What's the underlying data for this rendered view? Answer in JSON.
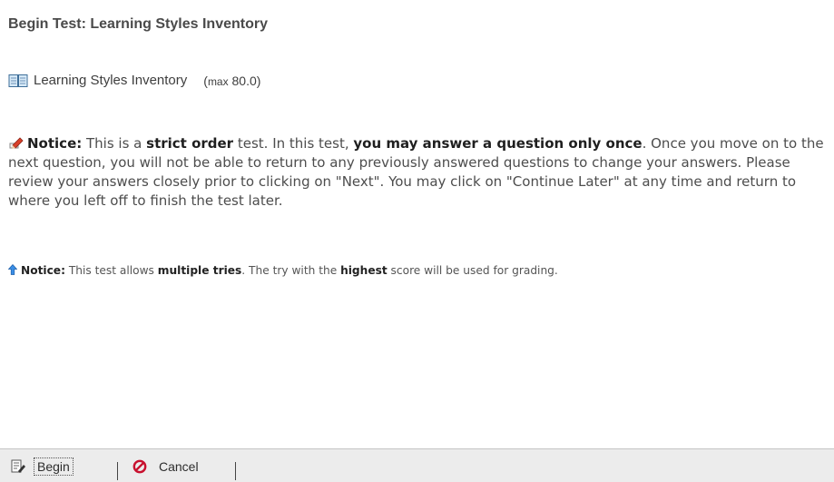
{
  "page": {
    "title": "Begin Test: Learning Styles Inventory"
  },
  "test": {
    "icon": "book-icon",
    "name": "Learning Styles Inventory",
    "max_open": "(",
    "max_label": "max",
    "max_value": " 80.0)"
  },
  "notice_strict": {
    "icon": "pencil-icon",
    "label": "Notice:",
    "t1": " This is a ",
    "b1": "strict order",
    "t2": " test. In this test, ",
    "b2": "you may answer a question only once",
    "t3": ". Once you move on to the next question, you will not be able to return to any previously answered questions to change your answers. Please review your answers closely prior to clicking on \"Next\". You may click on \"Continue Later\" at any time and return to where you left off to finish the test later."
  },
  "notice_tries": {
    "icon": "up-arrow-icon",
    "label": "Notice:",
    "t1": " This test allows ",
    "b1": "multiple tries",
    "t2": ". The try with the ",
    "b2": "highest",
    "t3": " score will be used for grading."
  },
  "toolbar": {
    "begin_icon": "edit-form-icon",
    "begin_label": "Begin",
    "cancel_icon": "cancel-icon",
    "cancel_label": "Cancel"
  },
  "colors": {
    "toolbar_bg": "#ececec",
    "cancel_red": "#c8102e",
    "pencil_red": "#d9412b",
    "arrow_blue": "#3a8ee6"
  }
}
